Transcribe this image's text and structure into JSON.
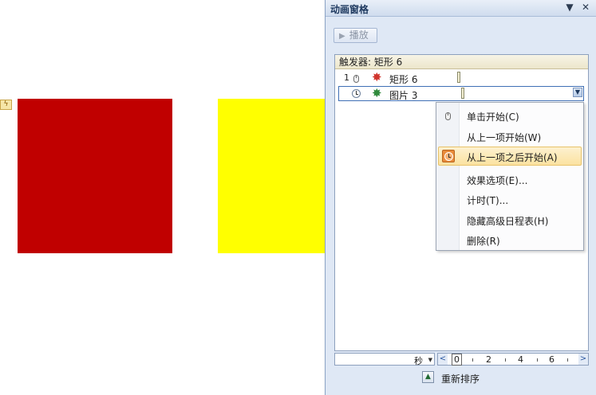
{
  "slide": {
    "trigger_tag_icon": "lightning-icon",
    "shapes": [
      {
        "name": "red-rectangle",
        "color": "#c00000"
      },
      {
        "name": "yellow-rectangle",
        "color": "#ffff00"
      }
    ]
  },
  "pane": {
    "title": "动画窗格",
    "dropdown_icon": "▼",
    "close_icon": "✕",
    "play_label": "播放",
    "trigger_label": "触发器: 矩形 6",
    "items": [
      {
        "number": "1",
        "start_icon": "mouse-icon",
        "effect_icon": "star-red-icon",
        "label": "矩形 6"
      },
      {
        "number": "",
        "start_icon": "clock-icon",
        "effect_icon": "star-green-icon",
        "label": "图片 3"
      }
    ]
  },
  "menu": {
    "items": [
      {
        "label": "单击开始(C)",
        "icon": "mouse-icon",
        "highlighted": false
      },
      {
        "label": "从上一项开始(W)",
        "icon": "",
        "highlighted": false
      },
      {
        "label": "从上一项之后开始(A)",
        "icon": "clock-icon",
        "highlighted": true
      },
      {
        "label": "效果选项(E)...",
        "icon": "",
        "highlighted": false
      },
      {
        "label": "计时(T)...",
        "icon": "",
        "highlighted": false
      },
      {
        "label": "隐藏高级日程表(H)",
        "icon": "",
        "highlighted": false
      },
      {
        "label": "删除(R)",
        "icon": "",
        "highlighted": false
      }
    ],
    "highlight_color": "#fbe2a1"
  },
  "timeline": {
    "unit": "秒",
    "ticks": [
      "0",
      "2",
      "4",
      "6"
    ],
    "prev_icon": "<",
    "next_icon": ">"
  },
  "reorder_label": "重新排序"
}
